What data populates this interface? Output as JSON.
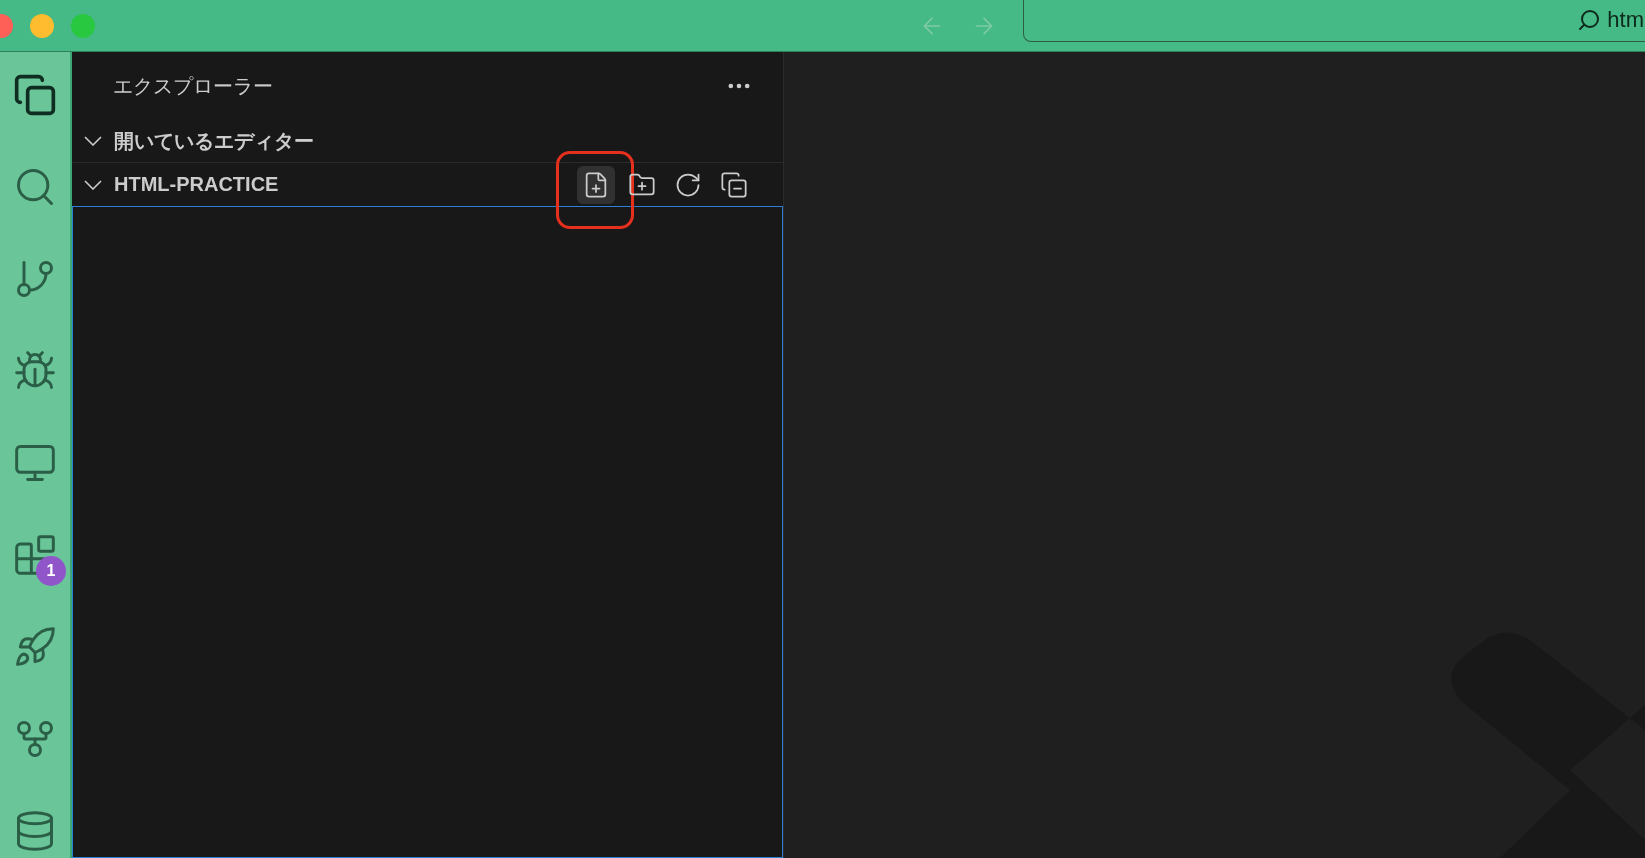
{
  "titlebar": {
    "search": {
      "value": "htm"
    }
  },
  "activity_bar": {
    "items": [
      {
        "selected": true
      },
      {
        "selected": false
      },
      {
        "selected": false
      },
      {
        "selected": false
      },
      {
        "selected": false
      },
      {
        "selected": false,
        "badge": "1"
      },
      {
        "selected": false
      },
      {
        "selected": false
      },
      {
        "selected": false
      }
    ]
  },
  "sidebar": {
    "title": "エクスプローラー",
    "sections": [
      {
        "label": "開いているエディター",
        "expanded": true,
        "focused": false
      },
      {
        "label": "HTML-PRACTICE",
        "expanded": true,
        "focused": true,
        "actions": [
          {
            "highlighted": true
          },
          {
            "highlighted": false
          },
          {
            "highlighted": false
          },
          {
            "highlighted": false
          }
        ]
      }
    ]
  }
}
